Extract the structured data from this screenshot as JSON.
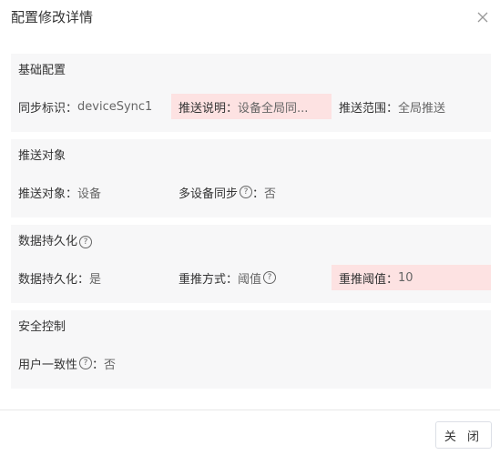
{
  "dialog": {
    "title": "配置修改详情",
    "close_icon": "close-icon",
    "footer": {
      "close_label": "关 闭"
    }
  },
  "sections": {
    "basic": {
      "title": "基础配置",
      "sync_id_label": "同步标识：",
      "sync_id_value": "deviceSync1",
      "push_desc_label": "推送说明：",
      "push_desc_value": "设备全局同...",
      "push_range_label": "推送范围：",
      "push_range_value": "全局推送"
    },
    "target": {
      "title": "推送对象",
      "push_target_label": "推送对象：",
      "push_target_value": "设备",
      "multi_sync_label": "多设备同步",
      "multi_sync_value": "否"
    },
    "persist": {
      "title": "数据持久化",
      "persist_label": "数据持久化：",
      "persist_value": "是",
      "retry_mode_label": "重推方式：",
      "retry_mode_value": "阈值",
      "retry_threshold_label": "重推阈值：",
      "retry_threshold_value": "10"
    },
    "security": {
      "title": "安全控制",
      "consistency_label": "用户一致性",
      "consistency_value": "否"
    }
  },
  "colors": {
    "highlight": "#fde2e2",
    "section_bg": "#f7f7f8",
    "text": "#333333",
    "muted": "#666666"
  },
  "icons": {
    "help": "question-circle-icon",
    "help_glyph": "?",
    "colon": "："
  }
}
